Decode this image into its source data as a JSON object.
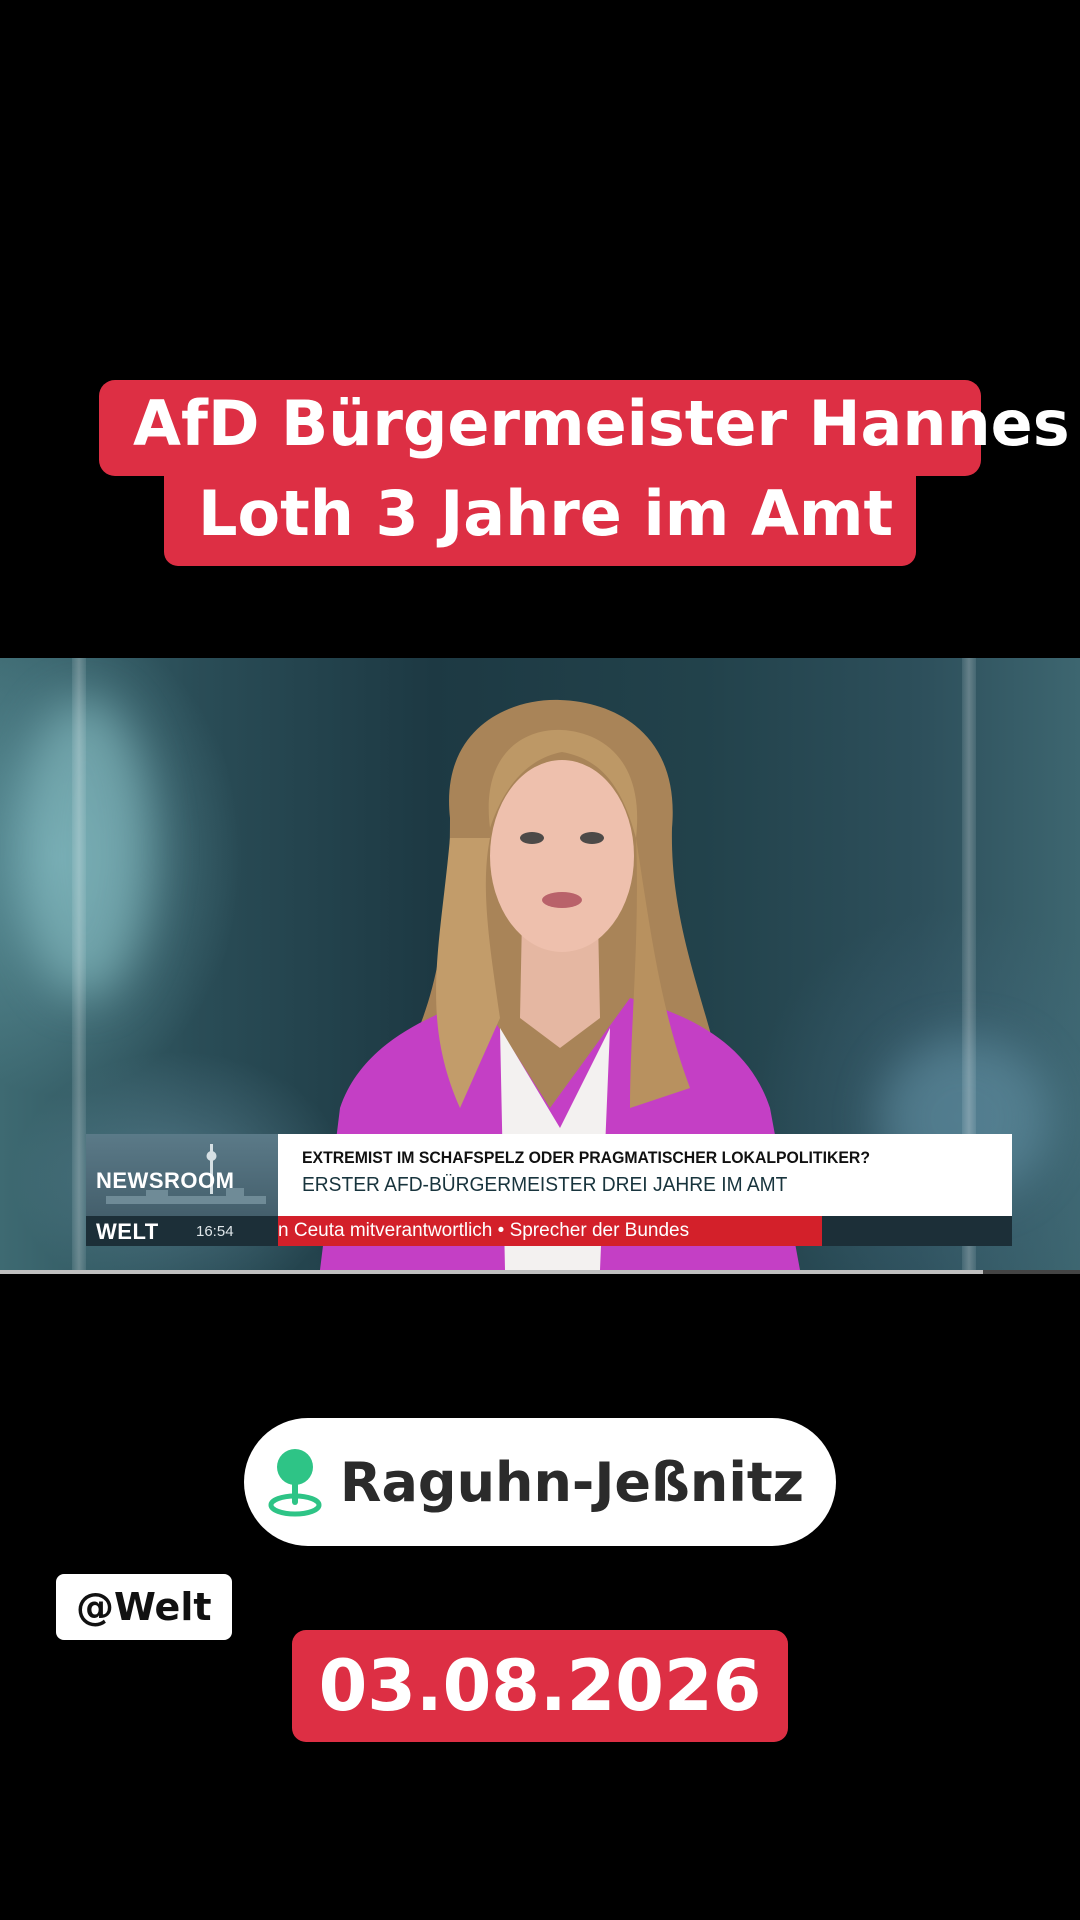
{
  "caption": {
    "line1": "AfD Bürgermeister Hannes",
    "line2": "Loth 3 Jahre im Amt",
    "background_color": "#dd2f44"
  },
  "video": {
    "lower_third": {
      "program": "NEWSROOM",
      "channel": "WELT",
      "time": "16:54",
      "headline1": "EXTREMIST IM SCHAFSPELZ ODER PRAGMATISCHER LOKALPOLITIKER?",
      "headline2": "ERSTER AFD-BÜRGERMEISTER DREI JAHRE IM AMT",
      "ticker": "n Ceuta mitverantwortlich  • Sprecher der Bundes",
      "ticker_color": "#d3202a"
    },
    "progress_fraction": 0.91
  },
  "location": {
    "icon": "location-pin-icon",
    "label": "Raguhn-Jeßnitz"
  },
  "handle": "@Welt",
  "date": "03.08.2026"
}
